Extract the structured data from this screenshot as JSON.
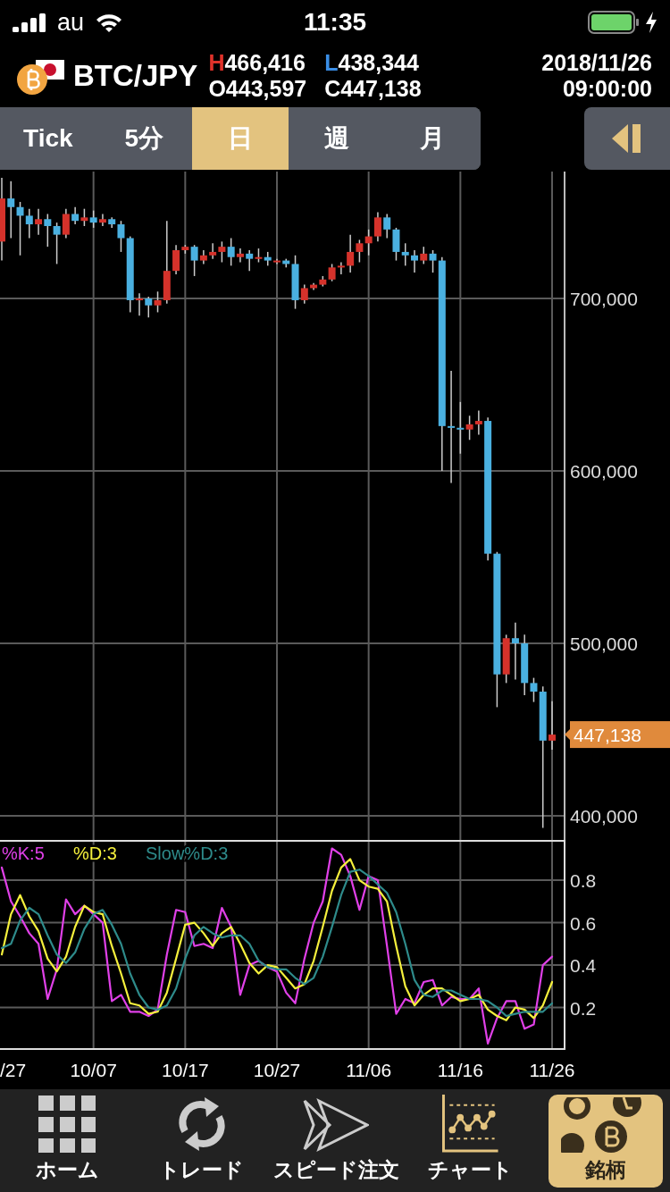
{
  "status_bar": {
    "carrier": "au",
    "time": "11:35"
  },
  "header": {
    "symbol": "BTC/JPY",
    "ohlc": [
      {
        "label": "H",
        "value": "466,416",
        "color": "#e0322a"
      },
      {
        "label": "L",
        "value": "438,344",
        "color": "#3a8ee6"
      },
      {
        "label": "O",
        "value": "443,597",
        "color": "#ffffff"
      },
      {
        "label": "C",
        "value": "447,138",
        "color": "#ffffff"
      }
    ],
    "date": "2018/11/26",
    "time": "09:00:00"
  },
  "tabs": [
    {
      "label": "Tick",
      "selected": false
    },
    {
      "label": "5分",
      "selected": false
    },
    {
      "label": "日",
      "selected": true
    },
    {
      "label": "週",
      "selected": false
    },
    {
      "label": "月",
      "selected": false
    }
  ],
  "price_chart": {
    "chart_data": {
      "type": "candlestick",
      "grid": true,
      "ylim": [
        386000,
        773600
      ],
      "categories": [
        null,
        null,
        null,
        null,
        null,
        null,
        null,
        null,
        null,
        null,
        null,
        null,
        null,
        null,
        null,
        null,
        null,
        null,
        null,
        null,
        null,
        null,
        null,
        null,
        null,
        null,
        null,
        null,
        null,
        null,
        null,
        null,
        null,
        null,
        null,
        null,
        null,
        null,
        null,
        null,
        null,
        null,
        null,
        null,
        null,
        null,
        null,
        null,
        null,
        null,
        null,
        null,
        null,
        null,
        null,
        null,
        null,
        null,
        null,
        null,
        null
      ],
      "yticks": [
        {
          "value": 400000,
          "label": "400,000"
        },
        {
          "value": 500000,
          "label": "500,000"
        },
        {
          "value": 600000,
          "label": "600,000"
        },
        {
          "value": 700000,
          "label": "700,000"
        }
      ],
      "ohlc": [
        [
          733000,
          770000,
          722000,
          758000
        ],
        [
          758000,
          768000,
          735000,
          753000
        ],
        [
          753000,
          756000,
          725000,
          748000
        ],
        [
          748000,
          752000,
          735000,
          743000
        ],
        [
          743000,
          752000,
          737000,
          746000
        ],
        [
          746000,
          749000,
          730000,
          742000
        ],
        [
          742000,
          744000,
          720000,
          737000
        ],
        [
          737000,
          752000,
          735000,
          749000
        ],
        [
          749000,
          753000,
          743000,
          745000
        ],
        [
          745000,
          752000,
          742000,
          747000
        ],
        [
          747000,
          751000,
          741000,
          744000
        ],
        [
          744000,
          749000,
          742000,
          746000
        ],
        [
          746000,
          747000,
          741000,
          743000
        ],
        [
          743000,
          745000,
          727000,
          735000
        ],
        [
          735000,
          736000,
          692000,
          699000
        ],
        [
          699000,
          703000,
          690000,
          700000
        ],
        [
          700000,
          701000,
          689000,
          696000
        ],
        [
          696000,
          704000,
          692000,
          699000
        ],
        [
          699000,
          745000,
          697000,
          716000
        ],
        [
          716000,
          731000,
          714000,
          728000
        ],
        [
          728000,
          731000,
          726000,
          730000
        ],
        [
          730000,
          731000,
          713000,
          722000
        ],
        [
          722000,
          728000,
          720000,
          725000
        ],
        [
          725000,
          732000,
          723000,
          727000
        ],
        [
          727000,
          733000,
          721000,
          730000
        ],
        [
          730000,
          735000,
          719000,
          724000
        ],
        [
          724000,
          729000,
          721000,
          726000
        ],
        [
          726000,
          728000,
          716000,
          723000
        ],
        [
          723000,
          729000,
          721000,
          724000
        ],
        [
          724000,
          727000,
          719000,
          722000
        ],
        [
          722000,
          723000,
          720000,
          722000
        ],
        [
          722000,
          723000,
          718000,
          720000
        ],
        [
          720000,
          725000,
          694000,
          699000
        ],
        [
          699000,
          708000,
          697000,
          706000
        ],
        [
          706000,
          709000,
          705000,
          708000
        ],
        [
          708000,
          713000,
          707000,
          711000
        ],
        [
          711000,
          720000,
          710000,
          718000
        ],
        [
          718000,
          721000,
          714000,
          719000
        ],
        [
          719000,
          737000,
          715000,
          727000
        ],
        [
          727000,
          734000,
          721000,
          732000
        ],
        [
          732000,
          740000,
          725000,
          736000
        ],
        [
          736000,
          750000,
          733000,
          747000
        ],
        [
          747000,
          749000,
          735000,
          740000
        ],
        [
          740000,
          741000,
          722000,
          727000
        ],
        [
          727000,
          732000,
          719000,
          725000
        ],
        [
          725000,
          728000,
          715000,
          722000
        ],
        [
          722000,
          730000,
          720000,
          726000
        ],
        [
          726000,
          728000,
          715000,
          722000
        ],
        [
          722000,
          724000,
          600000,
          626000
        ],
        [
          626000,
          658000,
          593000,
          625000
        ],
        [
          625000,
          640000,
          610000,
          624000
        ],
        [
          624000,
          632000,
          618000,
          627000
        ],
        [
          627000,
          635000,
          621000,
          629000
        ],
        [
          629000,
          631000,
          548000,
          552000
        ],
        [
          552000,
          553000,
          463000,
          482000
        ],
        [
          482000,
          505000,
          477000,
          503000
        ],
        [
          503000,
          512000,
          479000,
          500000
        ],
        [
          500000,
          505000,
          470000,
          477000
        ],
        [
          477000,
          480000,
          466000,
          472000
        ],
        [
          472000,
          475000,
          393000,
          443600
        ],
        [
          443600,
          466400,
          438300,
          447100
        ]
      ],
      "annotations": [
        "447,138"
      ]
    }
  },
  "oscillator": {
    "chart_data": {
      "type": "line",
      "grid": true,
      "ylim": [
        0,
        0.99
      ],
      "categories": [
        "/27",
        null,
        null,
        null,
        null,
        null,
        null,
        null,
        null,
        null,
        "10/07",
        null,
        null,
        null,
        null,
        null,
        null,
        null,
        null,
        null,
        "10/17",
        null,
        null,
        null,
        null,
        null,
        null,
        null,
        null,
        null,
        "10/27",
        null,
        null,
        null,
        null,
        null,
        null,
        null,
        null,
        null,
        "11/06",
        null,
        null,
        null,
        null,
        null,
        null,
        null,
        null,
        null,
        "11/16",
        null,
        null,
        null,
        null,
        null,
        null,
        null,
        null,
        null,
        "11/26"
      ],
      "yticks": [
        {
          "value": 0.2,
          "label": "0.2"
        },
        {
          "value": 0.4,
          "label": "0.4"
        },
        {
          "value": 0.6,
          "label": "0.6"
        },
        {
          "value": 0.8,
          "label": "0.8"
        }
      ],
      "series": [
        {
          "name": "%K:5",
          "color": "#e040e8",
          "values": [
            0.86,
            0.7,
            0.63,
            0.55,
            0.5,
            0.24,
            0.38,
            0.71,
            0.64,
            0.68,
            0.64,
            0.6,
            0.23,
            0.26,
            0.18,
            0.18,
            0.16,
            0.19,
            0.45,
            0.66,
            0.65,
            0.49,
            0.5,
            0.48,
            0.67,
            0.58,
            0.26,
            0.4,
            0.42,
            0.39,
            0.37,
            0.27,
            0.22,
            0.43,
            0.6,
            0.7,
            0.95,
            0.92,
            0.82,
            0.66,
            0.82,
            0.8,
            0.49,
            0.17,
            0.24,
            0.22,
            0.32,
            0.33,
            0.21,
            0.25,
            0.24,
            0.24,
            0.29,
            0.03,
            0.15,
            0.23,
            0.23,
            0.1,
            0.12,
            0.4,
            0.44
          ]
        },
        {
          "name": "%D:3",
          "color": "#f5f03c",
          "values": [
            0.45,
            0.64,
            0.73,
            0.63,
            0.56,
            0.43,
            0.37,
            0.44,
            0.58,
            0.68,
            0.65,
            0.64,
            0.49,
            0.36,
            0.22,
            0.21,
            0.17,
            0.18,
            0.27,
            0.43,
            0.59,
            0.6,
            0.55,
            0.49,
            0.55,
            0.58,
            0.5,
            0.41,
            0.36,
            0.4,
            0.39,
            0.34,
            0.29,
            0.31,
            0.42,
            0.58,
            0.75,
            0.86,
            0.9,
            0.8,
            0.77,
            0.76,
            0.7,
            0.49,
            0.3,
            0.21,
            0.26,
            0.29,
            0.29,
            0.26,
            0.23,
            0.24,
            0.26,
            0.19,
            0.16,
            0.14,
            0.2,
            0.19,
            0.15,
            0.21,
            0.32
          ]
        },
        {
          "name": "Slow%D:3",
          "color": "#2e8b8b",
          "values": [
            0.48,
            0.5,
            0.61,
            0.67,
            0.64,
            0.54,
            0.45,
            0.41,
            0.46,
            0.57,
            0.64,
            0.66,
            0.59,
            0.5,
            0.36,
            0.26,
            0.2,
            0.19,
            0.21,
            0.29,
            0.43,
            0.54,
            0.58,
            0.55,
            0.53,
            0.54,
            0.54,
            0.5,
            0.42,
            0.39,
            0.38,
            0.38,
            0.34,
            0.31,
            0.34,
            0.44,
            0.58,
            0.73,
            0.84,
            0.85,
            0.82,
            0.78,
            0.74,
            0.65,
            0.5,
            0.33,
            0.26,
            0.25,
            0.28,
            0.28,
            0.26,
            0.24,
            0.24,
            0.23,
            0.2,
            0.16,
            0.17,
            0.18,
            0.18,
            0.18,
            0.22
          ]
        }
      ]
    }
  },
  "bottom_nav": [
    {
      "kind": "home",
      "label": "ホーム",
      "selected": false
    },
    {
      "kind": "trade",
      "label": "トレード",
      "selected": false
    },
    {
      "kind": "speed_order",
      "label": "スピード注文",
      "selected": false
    },
    {
      "kind": "chart",
      "label": "チャート",
      "selected": false
    },
    {
      "kind": "symbols",
      "label": "銘柄",
      "selected": true
    }
  ]
}
